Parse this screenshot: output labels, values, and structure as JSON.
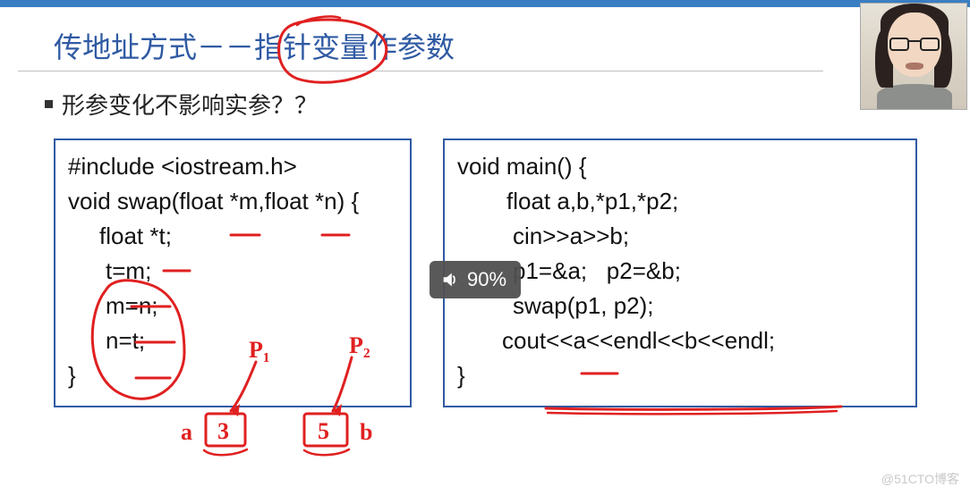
{
  "title": "传地址方式－－指针变量作参数",
  "bullet": "形参变化不影响实参？？",
  "code_left": {
    "l1": "#include <iostream.h>",
    "l2": "void swap(float *m,float *n) {",
    "l3": "float *t;",
    "l4": "t=m;",
    "l5": "m=n;",
    "l6": "n=t;",
    "l7": "}"
  },
  "code_right": {
    "l1": "void main() {",
    "l2": "float a,b,*p1,*p2;",
    "l3": "cin>>a>>b;",
    "l4": "p1=&a;   p2=&b;",
    "l5": "swap(p1, p2);",
    "l6": "cout<<a<<endl<<b<<endl;",
    "l7": "}"
  },
  "annotations": {
    "p1_label": "P₁",
    "p2_label": "P₂",
    "a_label": "a",
    "b_label": "b",
    "box_a_value": "3",
    "box_b_value": "5"
  },
  "osd": {
    "volume": "90%"
  },
  "watermark": "@51CTO博客"
}
